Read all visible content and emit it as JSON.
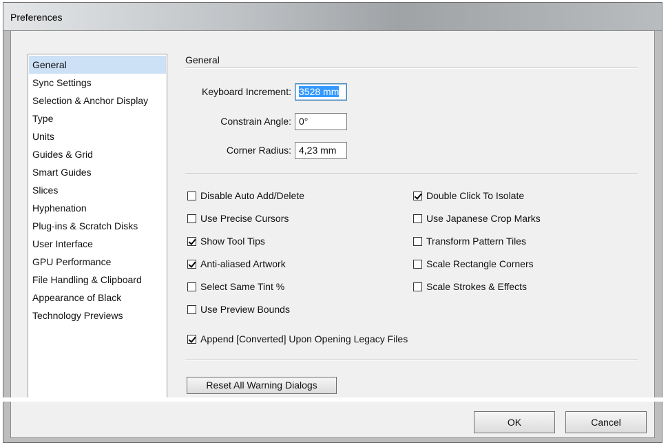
{
  "window": {
    "title": "Preferences"
  },
  "nav": {
    "items": [
      {
        "label": "General",
        "selected": true
      },
      {
        "label": "Sync Settings"
      },
      {
        "label": "Selection & Anchor Display"
      },
      {
        "label": "Type"
      },
      {
        "label": "Units"
      },
      {
        "label": "Guides & Grid"
      },
      {
        "label": "Smart Guides"
      },
      {
        "label": "Slices"
      },
      {
        "label": "Hyphenation"
      },
      {
        "label": "Plug-ins & Scratch Disks"
      },
      {
        "label": "User Interface"
      },
      {
        "label": "GPU Performance"
      },
      {
        "label": "File Handling & Clipboard"
      },
      {
        "label": "Appearance of Black"
      },
      {
        "label": "Technology Previews"
      }
    ]
  },
  "general": {
    "section_title": "General",
    "keyboard_increment": {
      "label": "Keyboard Increment:",
      "value": "3528 mm"
    },
    "constrain_angle": {
      "label": "Constrain Angle:",
      "value": "0°"
    },
    "corner_radius": {
      "label": "Corner Radius:",
      "value": "4,23 mm"
    },
    "left_options": [
      {
        "label": "Disable Auto Add/Delete",
        "checked": false
      },
      {
        "label": "Use Precise Cursors",
        "checked": false
      },
      {
        "label": "Show Tool Tips",
        "checked": true
      },
      {
        "label": "Anti-aliased Artwork",
        "checked": true
      },
      {
        "label": "Select Same Tint %",
        "checked": false
      },
      {
        "label": "Use Preview Bounds",
        "checked": false
      }
    ],
    "right_options": [
      {
        "label": "Double Click To Isolate",
        "checked": true
      },
      {
        "label": "Use Japanese Crop Marks",
        "checked": false
      },
      {
        "label": "Transform Pattern Tiles",
        "checked": false
      },
      {
        "label": "Scale Rectangle Corners",
        "checked": false
      },
      {
        "label": "Scale Strokes & Effects",
        "checked": false
      }
    ],
    "append_converted": {
      "label": "Append [Converted] Upon Opening Legacy Files",
      "checked": true
    },
    "reset_warnings_label": "Reset All Warning Dialogs"
  },
  "footer": {
    "ok_label": "OK",
    "cancel_label": "Cancel"
  }
}
